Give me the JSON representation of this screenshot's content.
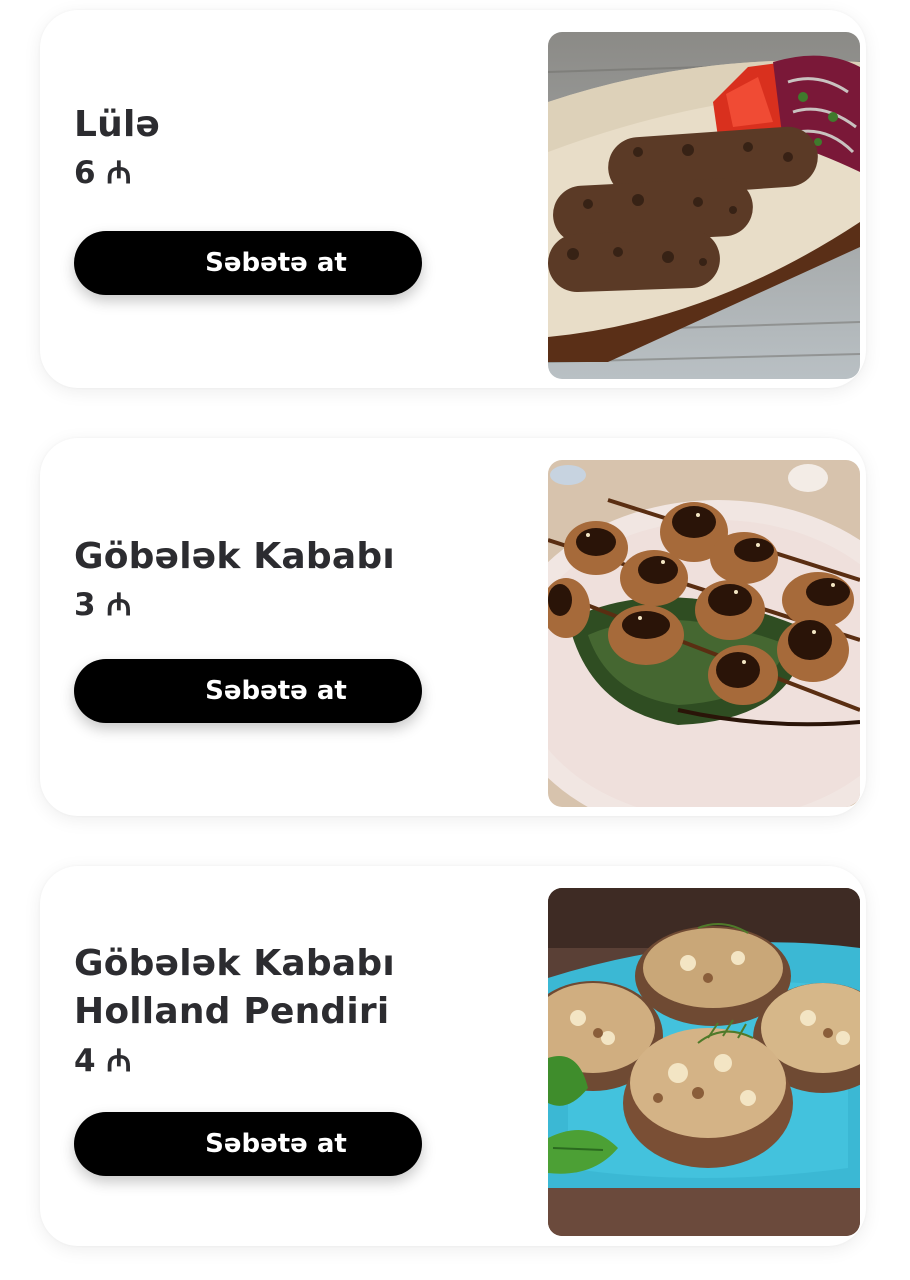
{
  "items": [
    {
      "name": "Lülə",
      "price": "6 ₼",
      "button_label": "Səbətə at",
      "image_alt": "Lülə"
    },
    {
      "name": "Göbələk Kababı",
      "price": "3 ₼",
      "button_label": "Səbətə at",
      "image_alt": "Göbələk Kababı"
    },
    {
      "name": "Göbələk Kababı Holland Pendiri",
      "price": "4 ₼",
      "button_label": "Səbətə at",
      "image_alt": "Göbələk Kababı Holland Pendiri"
    }
  ],
  "colors": {
    "button_bg": "#000000",
    "button_text": "#ffffff",
    "text": "#2c2c30",
    "card_bg": "#ffffff"
  }
}
